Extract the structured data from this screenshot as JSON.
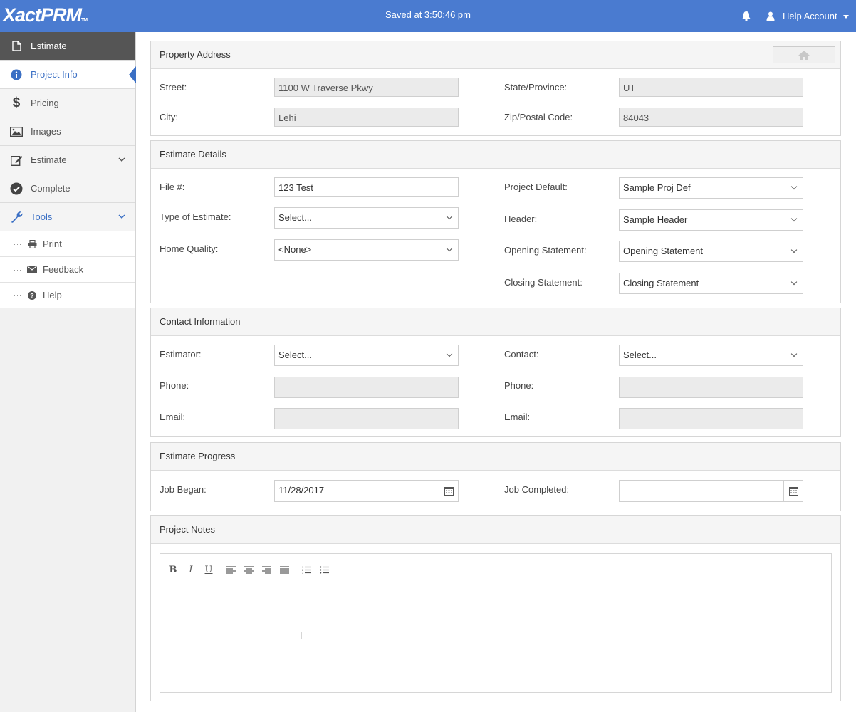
{
  "app": {
    "logo": "XactPRM",
    "logo_tm": "TM",
    "saved_status": "Saved at 3:50:46 pm",
    "account_label": "Help Account"
  },
  "sidebar": {
    "items": [
      {
        "label": "Estimate",
        "icon": "document-icon"
      },
      {
        "label": "Project Info",
        "icon": "info-icon"
      },
      {
        "label": "Pricing",
        "icon": "dollar-icon"
      },
      {
        "label": "Images",
        "icon": "image-icon"
      },
      {
        "label": "Estimate",
        "icon": "edit-icon"
      },
      {
        "label": "Complete",
        "icon": "check-circle-icon"
      },
      {
        "label": "Tools",
        "icon": "wrench-icon"
      }
    ],
    "sub_items": [
      {
        "label": "Print",
        "icon": "printer-icon"
      },
      {
        "label": "Feedback",
        "icon": "envelope-icon"
      },
      {
        "label": "Help",
        "icon": "question-icon"
      }
    ]
  },
  "property_address": {
    "title": "Property Address",
    "street_label": "Street:",
    "street_value": "1100 W Traverse Pkwy",
    "city_label": "City:",
    "city_value": "Lehi",
    "state_label": "State/Province:",
    "state_value": "UT",
    "zip_label": "Zip/Postal Code:",
    "zip_value": "84043"
  },
  "estimate_details": {
    "title": "Estimate Details",
    "file_label": "File #:",
    "file_value": "123 Test",
    "type_label": "Type of Estimate:",
    "type_value": "Select...",
    "quality_label": "Home Quality:",
    "quality_value": "<None>",
    "project_default_label": "Project Default:",
    "project_default_value": "Sample Proj Def",
    "header_label": "Header:",
    "header_value": "Sample Header",
    "opening_label": "Opening Statement:",
    "opening_value": "Opening Statement",
    "closing_label": "Closing Statement:",
    "closing_value": "Closing Statement"
  },
  "contact_info": {
    "title": "Contact Information",
    "estimator_label": "Estimator:",
    "estimator_value": "Select...",
    "phone_label": "Phone:",
    "phone_value": "",
    "email_label": "Email:",
    "email_value": "",
    "contact_label": "Contact:",
    "contact_value": "Select...",
    "contact_phone_label": "Phone:",
    "contact_phone_value": "",
    "contact_email_label": "Email:",
    "contact_email_value": ""
  },
  "estimate_progress": {
    "title": "Estimate Progress",
    "began_label": "Job Began:",
    "began_value": "11/28/2017",
    "completed_label": "Job Completed:",
    "completed_value": ""
  },
  "project_notes": {
    "title": "Project Notes",
    "toolbar": {
      "bold": "B",
      "italic": "I",
      "underline": "U"
    },
    "content": ""
  },
  "colors": {
    "topbar": "#4a7bd0",
    "accent": "#3a6fc4",
    "sidebar_dark": "#555555"
  }
}
